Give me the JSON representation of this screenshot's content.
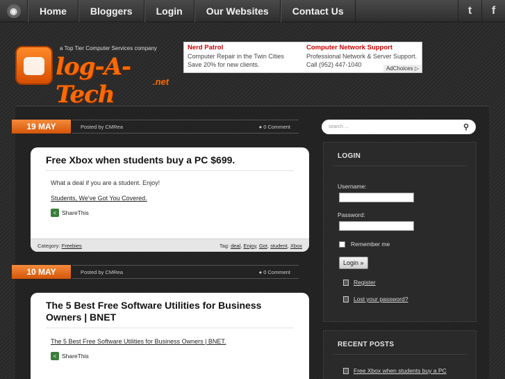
{
  "nav": {
    "rss_icon": "rss-icon",
    "items": [
      "Home",
      "Bloggers",
      "Login",
      "Our Websites",
      "Contact Us"
    ],
    "social": [
      {
        "icon": "twitter-icon",
        "glyph": "t"
      },
      {
        "icon": "facebook-icon",
        "glyph": "f"
      }
    ]
  },
  "header": {
    "tagline": "a Top Tier Computer Services company",
    "logo_name": "log-A-Tech",
    "logo_suffix": ".net"
  },
  "ad": {
    "left_title": "Nerd Patrol",
    "left_text": "Computer Repair in the Twin Cities Save 20% for new clients.",
    "right_title": "Computer Network Support",
    "right_text": "Professional Network & Server Support. Call (952) 447-1040",
    "choices": "AdChoices ▷"
  },
  "posts": [
    {
      "date": "19 MAY",
      "posted_by": "Posted by CMRea",
      "comments": "0 Comment",
      "title": "Free Xbox when students buy a PC $699.",
      "text": "What a deal if you are a student. Enjoy!",
      "link": "Students, We've Got You Covered.",
      "share": "ShareThis",
      "category_label": "Category:",
      "category": "Freebies",
      "tag_label": "Tag:",
      "tags": [
        "deal",
        "Enjoy",
        "Got",
        "student",
        "Xbox"
      ]
    },
    {
      "date": "10 MAY",
      "posted_by": "Posted by CMRea",
      "comments": "0 Comment",
      "title": "The 5 Best Free Software Utilities for Business Owners | BNET",
      "link": "The 5 Best Free Software Utilities for Business Owners | BNET.",
      "share": "ShareThis"
    }
  ],
  "sidebar": {
    "search_placeholder": "search ...",
    "login": {
      "title": "LOGIN",
      "username_label": "Username:",
      "password_label": "Password:",
      "remember_label": "Remember me",
      "button": "Login »",
      "register": "Register",
      "lost_password": "Lost your password?"
    },
    "recent": {
      "title": "RECENT POSTS",
      "items": [
        "Free Xbox when students buy a PC"
      ]
    }
  }
}
